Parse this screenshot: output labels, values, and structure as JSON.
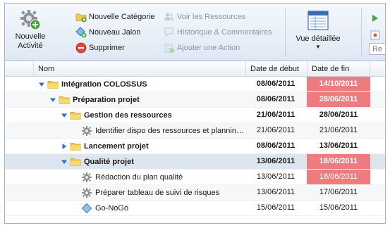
{
  "toolbar": {
    "new_activity_label_line1": "Nouvelle",
    "new_activity_label_line2": "Activité",
    "col1": [
      {
        "label": "Nouvelle Catégorie",
        "icon": "folder-add-icon",
        "enabled": true
      },
      {
        "label": "Nouveau Jalon",
        "icon": "milestone-add-icon",
        "enabled": true
      },
      {
        "label": "Supprimer",
        "icon": "delete-icon",
        "enabled": true
      }
    ],
    "col2": [
      {
        "label": "Voir les Ressources",
        "icon": "resources-icon",
        "enabled": false
      },
      {
        "label": "Historique & Commentaires",
        "icon": "comments-icon",
        "enabled": false
      },
      {
        "label": "Ajouter une Action",
        "icon": "add-action-icon",
        "enabled": false
      }
    ],
    "view_label": "Vue détaillée",
    "search_placeholder": "Re"
  },
  "grid": {
    "columns": [
      "Nom",
      "Date de début",
      "Date de fin"
    ],
    "rows": [
      {
        "name": "Intégration COLOSSUS",
        "start": "08/06/2011",
        "end": "14/10/2011",
        "level": 0,
        "type": "folder",
        "expander": "expanded",
        "bold": true,
        "late": true
      },
      {
        "name": "Préparation projet",
        "start": "08/06/2011",
        "end": "28/06/2011",
        "level": 1,
        "type": "folder",
        "expander": "expanded",
        "bold": true,
        "late": true
      },
      {
        "name": "Gestion des ressources",
        "start": "21/06/2011",
        "end": "28/06/2011",
        "level": 2,
        "type": "folder",
        "expander": "expanded",
        "bold": true,
        "late": false
      },
      {
        "name": "Identifier dispo des ressources et plannin…",
        "start": "21/06/2011",
        "end": "21/06/2011",
        "level": 3,
        "type": "task",
        "expander": "none",
        "bold": false,
        "late": false
      },
      {
        "name": "Lancement projet",
        "start": "08/06/2011",
        "end": "13/06/2011",
        "level": 2,
        "type": "folder",
        "expander": "collapsed",
        "bold": true,
        "late": false
      },
      {
        "name": "Qualité projet",
        "start": "13/06/2011",
        "end": "18/06/2011",
        "level": 2,
        "type": "folder",
        "expander": "expanded",
        "bold": true,
        "late": true,
        "selected": true
      },
      {
        "name": "Rédaction du plan qualité",
        "start": "13/06/2011",
        "end": "18/06/2011",
        "level": 3,
        "type": "task",
        "expander": "none",
        "bold": false,
        "late": true
      },
      {
        "name": "Préparer tableau de suivi de risques",
        "start": "13/06/2011",
        "end": "17/06/2011",
        "level": 3,
        "type": "task",
        "expander": "none",
        "bold": false,
        "late": false
      },
      {
        "name": "Go-NoGo",
        "start": "15/06/2011",
        "end": "15/06/2011",
        "level": 3,
        "type": "milestone",
        "expander": "none",
        "bold": false,
        "late": false
      }
    ]
  },
  "colors": {
    "late_bg": "#ee7b7f",
    "selected_row": "#dde5ee",
    "toolbar_top": "#f4f8fc",
    "toolbar_bottom": "#dfe8f3"
  }
}
